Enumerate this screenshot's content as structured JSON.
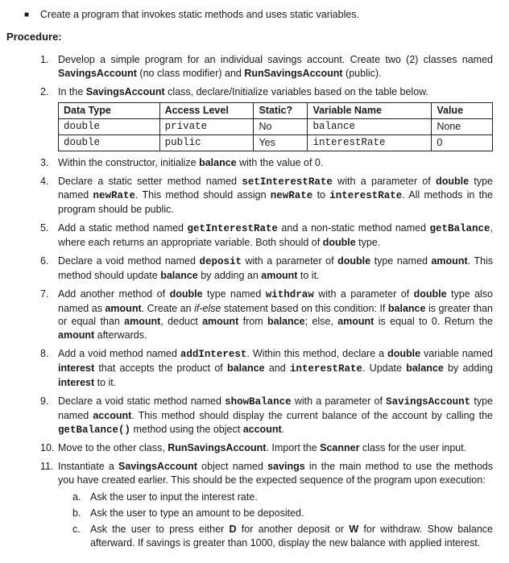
{
  "bullet": {
    "text": "Create a program that invokes static methods and uses static variables."
  },
  "procedure_label": "Procedure:",
  "steps": [
    {
      "html": "Develop a simple program for an individual savings account. Create two (2) classes named <span class='b'>SavingsAccount</span> (no class modifier) and <span class='b'>RunSavingsAccount</span> (public)."
    },
    {
      "html": "In the <span class='b'>SavingsAccount</span> class, declare/Initialize variables based on the table below."
    },
    {
      "html": "Within the constructor, initialize <span class='b'>balance</span> with the value of 0."
    },
    {
      "html": "Declare a static setter method named <span class='b mono'>setInterestRate</span> with a parameter of <span class='b'>double</span> type named <span class='b mono'>newRate</span>. This method should assign <span class='b mono'>newRate</span> to <span class='b mono'>interestRate</span>. All methods in the program should be public."
    },
    {
      "html": "Add a static method named <span class='b mono'>getInterestRate</span> and a non-static method named <span class='b mono'>getBalance</span>, where each returns an appropriate variable. Both should of <span class='b'>double</span> type."
    },
    {
      "html": "Declare a void method named <span class='b mono'>deposit</span> with a parameter of <span class='b'>double</span> type named <span class='b'>amount</span>. This method should update <span class='b'>balance</span> by adding an <span class='b'>amount</span> to it."
    },
    {
      "html": "Add another method of <span class='b'>double</span> type named <span class='b mono'>withdraw</span> with a parameter of <span class='b'>double</span> type also named as <span class='b'>amount</span>. Create an <span class='i'>if-else</span> statement based on this condition: If <span class='b'>balance</span> is greater than or equal than <span class='b'>amount</span>, deduct <span class='b'>amount</span> from <span class='b'>balance</span>; else, <span class='b'>amount</span> is equal to 0. Return the <span class='b'>amount</span> afterwards."
    },
    {
      "html": "Add a void method named <span class='b mono'>addInterest</span>. Within this method, declare a <span class='b'>double</span> variable named <span class='b'>interest</span> that accepts the product of <span class='b'>balance</span> and <span class='b mono'>interestRate</span>. Update <span class='b'>balance</span> by adding <span class='b'>interest</span> to it."
    },
    {
      "html": "Declare a void static method named <span class='b mono'>showBalance</span> with a parameter of <span class='b mono'>SavingsAccount</span> type named <span class='b'>account</span>. This method should display the current balance of the account by calling the <span class='b mono'>getBalance()</span> method using the object <span class='b'>account</span>."
    },
    {
      "html": "Move to the other class, <span class='b'>RunSavingsAccount</span>. Import the <span class='b'>Scanner</span> class for the user input."
    },
    {
      "html": "Instantiate a <span class='b'>SavingsAccount</span> object named <span class='b'>savings</span> in the main method to use the methods you have created earlier. This should be the expected sequence of the program upon execution:"
    }
  ],
  "table": {
    "headers": [
      "Data Type",
      "Access Level",
      "Static?",
      "Variable Name",
      "Value"
    ],
    "rows": [
      [
        "double",
        "private",
        "No",
        "balance",
        "None"
      ],
      [
        "double",
        "public",
        "Yes",
        "interestRate",
        "0"
      ]
    ]
  },
  "substeps": [
    {
      "html": "Ask the user to input the interest rate."
    },
    {
      "html": "Ask the user to type an amount to be deposited."
    },
    {
      "html": "Ask the user to press either <span class='b'>D</span> for another deposit or <span class='b'>W</span> for withdraw. Show balance afterward. If savings is greater than 1000, display the new balance with applied interest."
    }
  ]
}
